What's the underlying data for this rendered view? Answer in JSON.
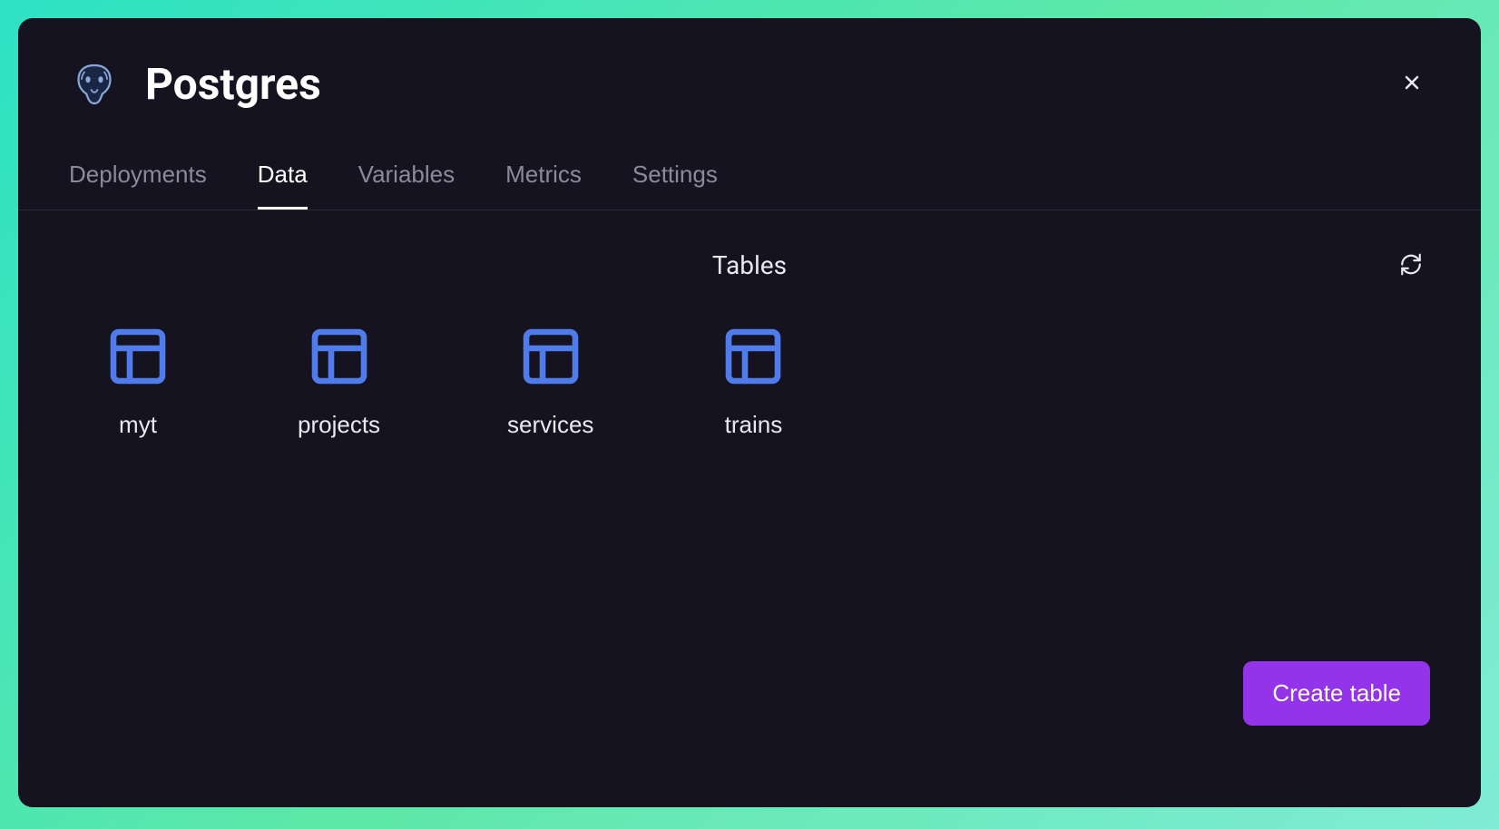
{
  "header": {
    "title": "Postgres"
  },
  "tabs": [
    {
      "label": "Deployments",
      "active": false
    },
    {
      "label": "Data",
      "active": true
    },
    {
      "label": "Variables",
      "active": false
    },
    {
      "label": "Metrics",
      "active": false
    },
    {
      "label": "Settings",
      "active": false
    }
  ],
  "section": {
    "title": "Tables"
  },
  "tables": [
    {
      "name": "myt"
    },
    {
      "name": "projects"
    },
    {
      "name": "services"
    },
    {
      "name": "trains"
    }
  ],
  "create_button": {
    "label": "Create table"
  },
  "colors": {
    "accent": "#4F7BEB",
    "purple": "#9333EA"
  }
}
